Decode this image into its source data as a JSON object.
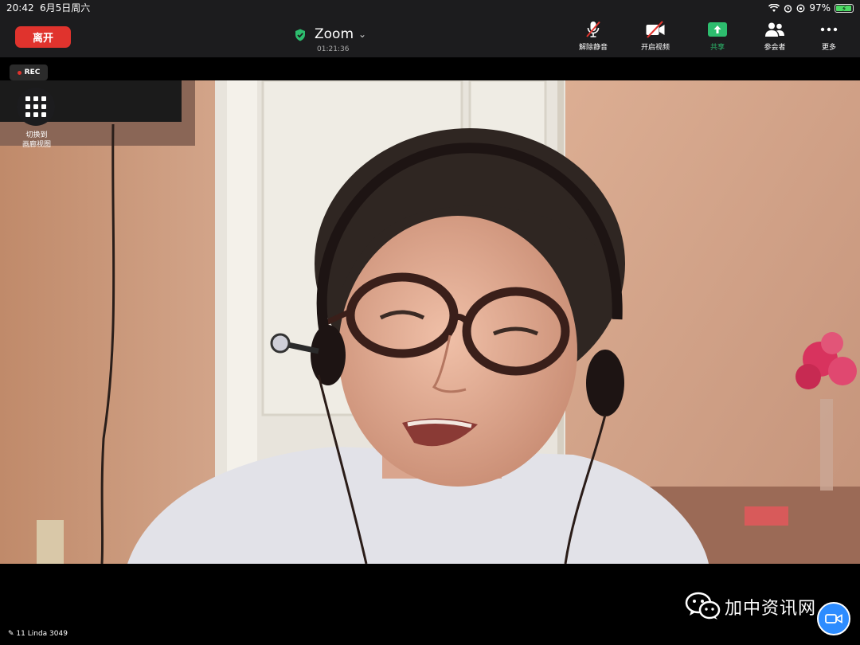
{
  "status_bar": {
    "time": "20:42",
    "date": "6月5日周六",
    "battery_percent": "97%",
    "battery_level": 0.97
  },
  "toolbar": {
    "leave_label": "离开",
    "meeting_title": "Zoom",
    "timer": "01:21:36",
    "buttons": {
      "unmute": "解除静音",
      "start_video": "开启视频",
      "share": "共享",
      "participants": "参会者",
      "more": "更多"
    },
    "share_color": "#2dbd6e",
    "leave_color": "#e0332d"
  },
  "overlay": {
    "rec_label": "REC",
    "gallery_label": "切换到\n画廊视图"
  },
  "participant": {
    "name_label": "11 Linda 3049"
  },
  "watermark": {
    "text": "加中资讯网",
    "icon": "wechat-icon"
  },
  "icons": {
    "security": "shield-check-icon",
    "mic": "mic-off-icon",
    "video": "video-off-icon",
    "share": "share-arrow-icon",
    "participants": "people-icon",
    "more": "more-dots-icon",
    "gallery": "grid-icon",
    "fab": "camera-icon"
  }
}
